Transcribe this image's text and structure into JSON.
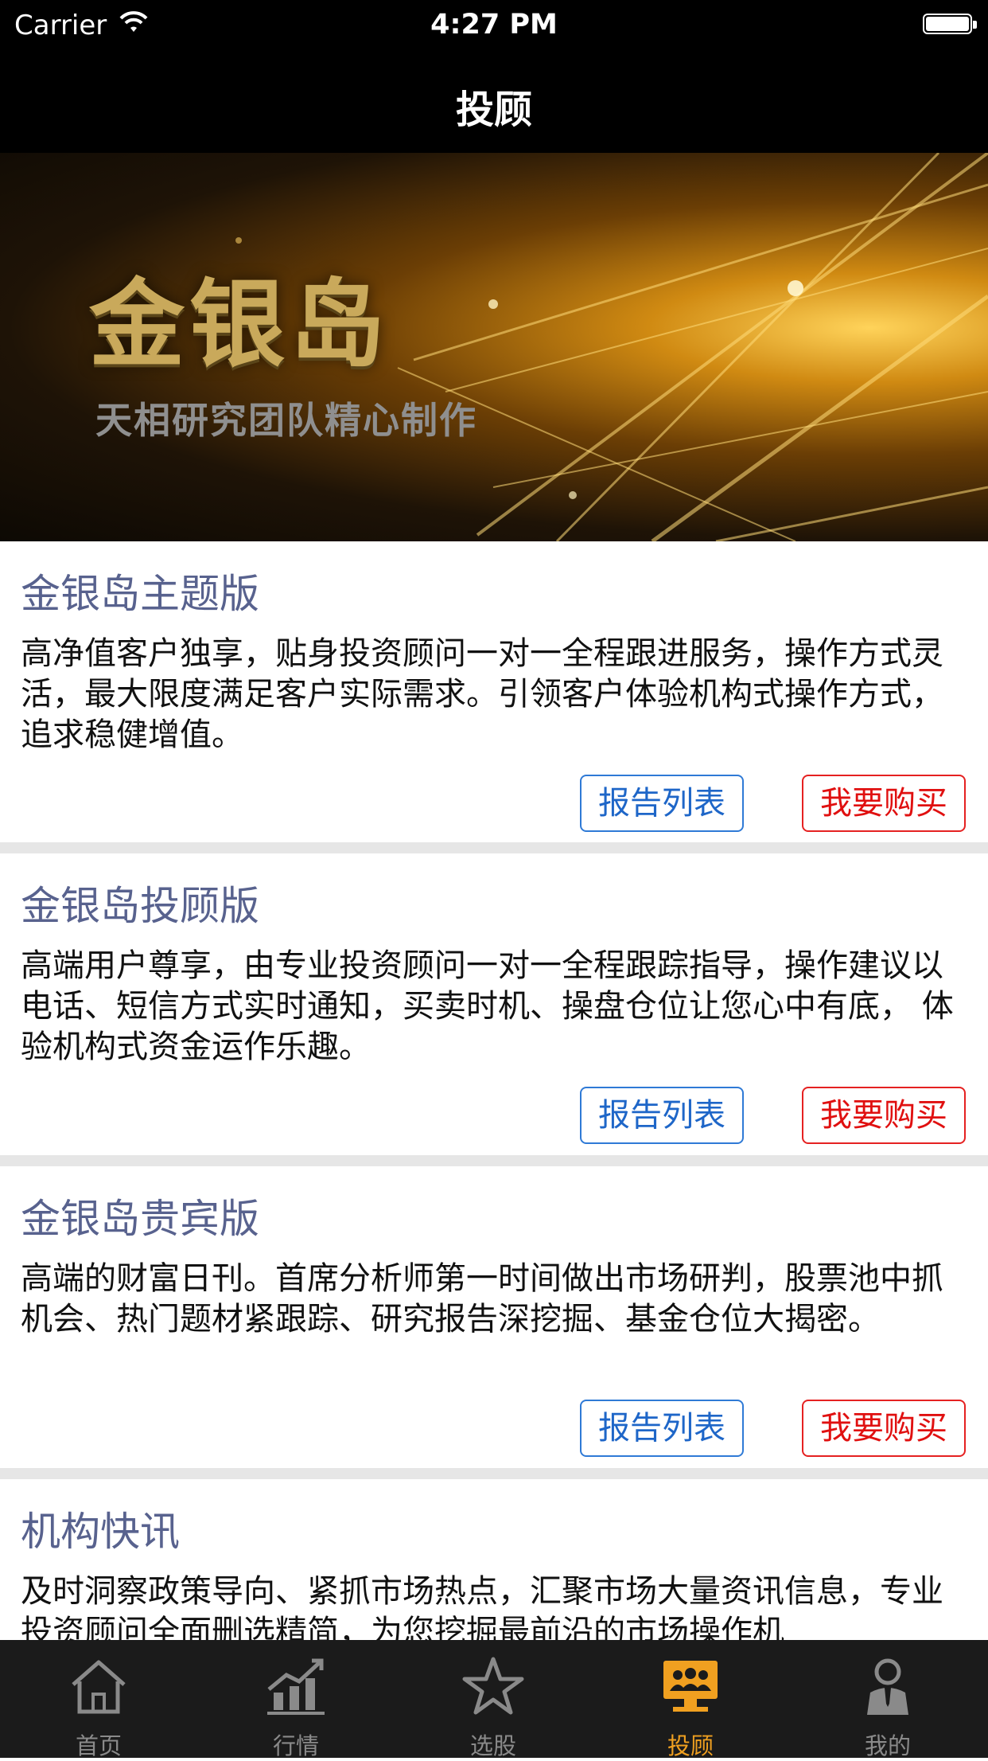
{
  "status_bar": {
    "carrier": "Carrier",
    "time": "4:27 PM"
  },
  "nav": {
    "title": "投顾"
  },
  "banner": {
    "title": "金银岛",
    "subtitle": "天相研究团队精心制作"
  },
  "products": [
    {
      "title": "金银岛主题版",
      "description": "高净值客户独享，贴身投资顾问一对一全程跟进服务，操作方式灵活，最大限度满足客户实际需求。引领客户体验机构式操作方式，追求稳健增值。",
      "report_label": "报告列表",
      "buy_label": "我要购买"
    },
    {
      "title": "金银岛投顾版",
      "description": "高端用户尊享，由专业投资顾问一对一全程跟踪指导，操作建议以电话、短信方式实时通知，买卖时机、操盘仓位让您心中有底， 体验机构式资金运作乐趣。",
      "report_label": "报告列表",
      "buy_label": "我要购买"
    },
    {
      "title": "金银岛贵宾版",
      "description": "高端的财富日刊。首席分析师第一时间做出市场研判，股票池中抓机会、热门题材紧跟踪、研究报告深挖掘、基金仓位大揭密。",
      "report_label": "报告列表",
      "buy_label": "我要购买"
    },
    {
      "title": "机构快讯",
      "description": "及时洞察政策导向、紧抓市场热点，汇聚市场大量资讯信息，专业投资顾问全面删选精简，为您挖掘最前沿的市场操作机"
    }
  ],
  "tabs": [
    {
      "label": "首页",
      "icon": "home-icon"
    },
    {
      "label": "行情",
      "icon": "chart-icon"
    },
    {
      "label": "选股",
      "icon": "star-icon"
    },
    {
      "label": "投顾",
      "icon": "advisor-icon",
      "active": true
    },
    {
      "label": "我的",
      "icon": "profile-icon"
    }
  ],
  "colors": {
    "accent": "#f0a020",
    "title": "#58628e",
    "report_button": "#1e66c8",
    "buy_button": "#e01010"
  }
}
